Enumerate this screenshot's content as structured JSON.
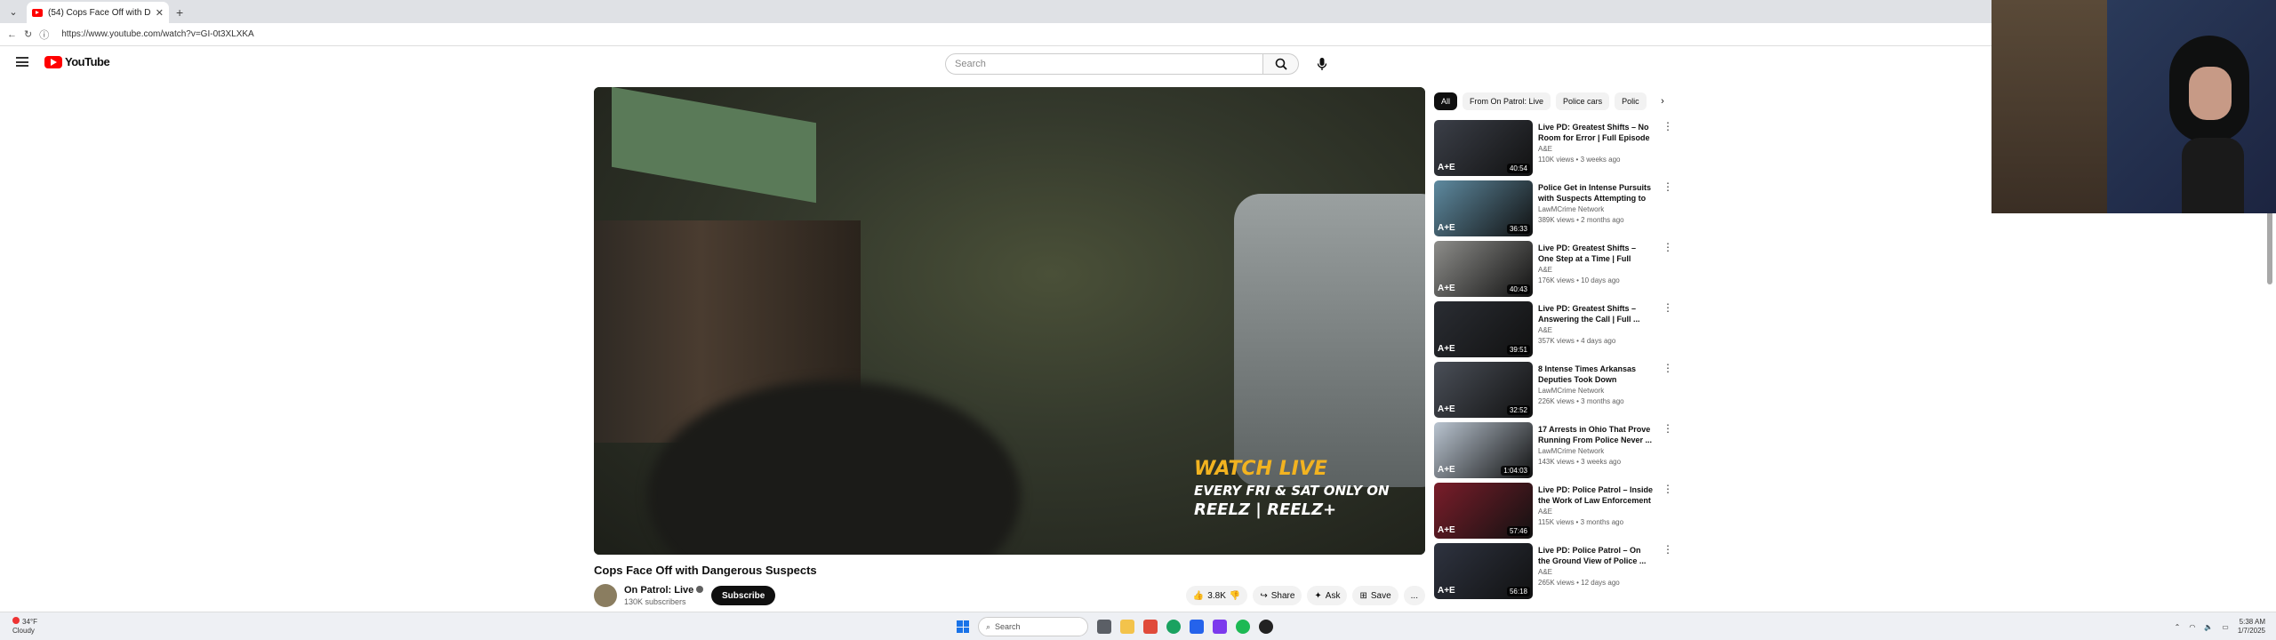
{
  "browser": {
    "tab_title": "(54) Cops Face Off with Dang...",
    "new_tab": "+",
    "url": "https://www.youtube.com/watch?v=GI-0t3XLXKA"
  },
  "youtube": {
    "logo_text": "YouTube",
    "search_placeholder": "Search"
  },
  "video": {
    "overlay_line1": "WATCH LIVE",
    "overlay_line2": "EVERY FRI & SAT ONLY ON",
    "overlay_line3": "REELZ | REELZ+",
    "title": "Cops Face Off with Dangerous Suspects",
    "channel_name": "On Patrol: Live",
    "subscribers": "130K subscribers",
    "subscribe_label": "Subscribe",
    "likes": "3.8K",
    "share_label": "Share",
    "ask_label": "Ask",
    "save_label": "Save",
    "more_label": "..."
  },
  "chips": [
    "All",
    "From On Patrol: Live",
    "Police cars",
    "Polic"
  ],
  "recommendations": [
    {
      "title": "Live PD: Greatest Shifts – No Room for Error | Full Episode",
      "channel": "A&E",
      "meta": "110K views • 3 weeks ago",
      "duration": "40:54",
      "thumb_color": "#3b3f48"
    },
    {
      "title": "Police Get in Intense Pursuits with Suspects Attempting to ...",
      "channel": "LawMCrime Network",
      "meta": "389K views • 2 months ago",
      "duration": "36:33",
      "thumb_color": "#5e8aa0"
    },
    {
      "title": "Live PD: Greatest Shifts – One Step at a Time | Full Episode",
      "channel": "A&E",
      "meta": "176K views • 10 days ago",
      "duration": "40:43",
      "thumb_color": "#8d8d8a"
    },
    {
      "title": "Live PD: Greatest Shifts – Answering the Call | Full ...",
      "channel": "A&E",
      "meta": "357K views • 4 days ago",
      "duration": "39:51",
      "thumb_color": "#2a2d33"
    },
    {
      "title": "8 Intense Times Arkansas Deputies Took Down Dangerous...",
      "channel": "LawMCrime Network",
      "meta": "226K views • 3 months ago",
      "duration": "32:52",
      "thumb_color": "#4a4f58"
    },
    {
      "title": "17 Arrests in Ohio That Prove Running From Police Never ...",
      "channel": "LawMCrime Network",
      "meta": "143K views • 3 weeks ago",
      "duration": "1:04:03",
      "thumb_color": "#b9c4d0"
    },
    {
      "title": "Live PD: Police Patrol – Inside the Work of Law Enforcement ...",
      "channel": "A&E",
      "meta": "115K views • 3 months ago",
      "duration": "57:46",
      "thumb_color": "#7a1d2a"
    },
    {
      "title": "Live PD: Police Patrol – On the Ground View of Police ...",
      "channel": "A&E",
      "meta": "265K views • 12 days ago",
      "duration": "56:18",
      "thumb_color": "#2e3340"
    }
  ],
  "taskbar": {
    "weather_temp": "34°F",
    "weather_desc": "Cloudy",
    "search_label": "Search",
    "time": "5:38 AM",
    "date": "1/7/2025"
  }
}
